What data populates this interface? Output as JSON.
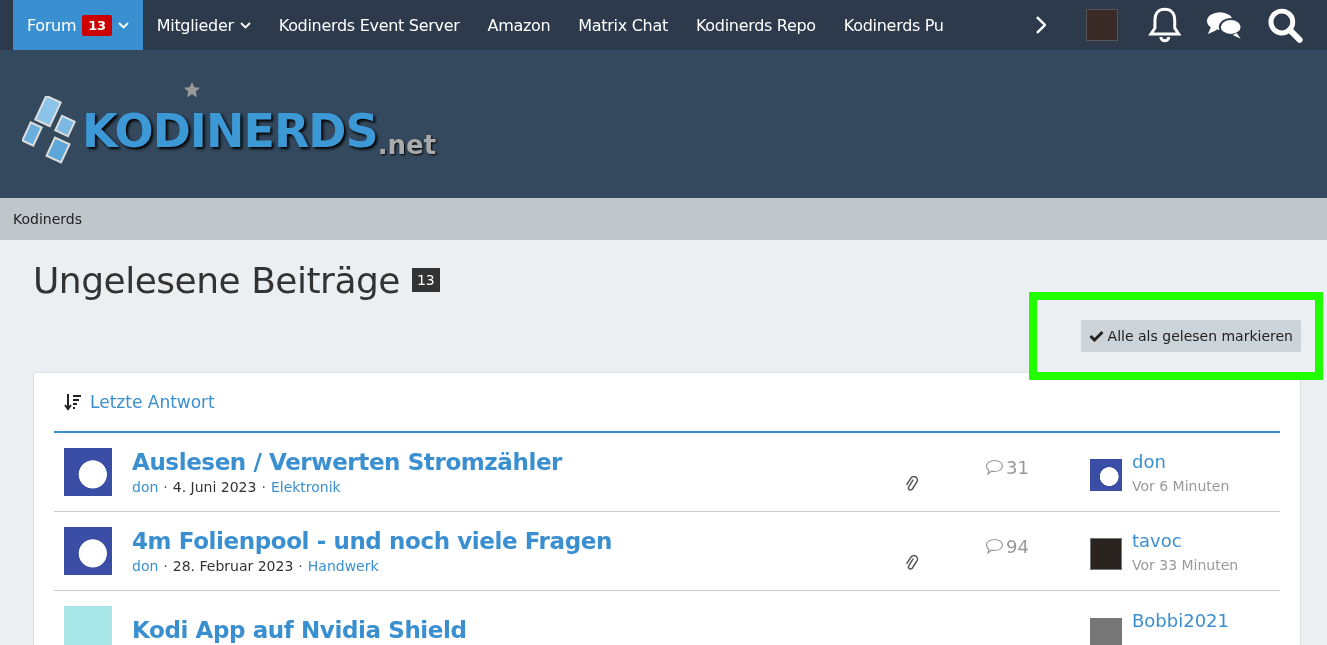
{
  "nav": {
    "items": [
      {
        "label": "Forum",
        "badge": "13",
        "dropdown": true,
        "selected": true
      },
      {
        "label": "Mitglieder",
        "dropdown": true,
        "selected": false
      },
      {
        "label": "Kodinerds Event Server",
        "dropdown": false,
        "selected": false
      },
      {
        "label": "Amazon",
        "dropdown": false,
        "selected": false
      },
      {
        "label": "Matrix Chat",
        "dropdown": false,
        "selected": false
      },
      {
        "label": "Kodinerds Repo",
        "dropdown": false,
        "selected": false
      },
      {
        "label": "Kodinerds Pu",
        "dropdown": false,
        "selected": false
      }
    ]
  },
  "logo": {
    "name": "KODINERDS",
    "suffix": ".net"
  },
  "breadcrumb": [
    "Kodinerds"
  ],
  "page": {
    "title": "Ungelesene Beiträge",
    "count": "13",
    "mark_all_button": "Alle als gelesen markieren"
  },
  "list": {
    "sort_label": "Letzte Antwort",
    "separator": "·",
    "threads": [
      {
        "title": "Auslesen / Verwerten Stromzähler",
        "author": "don",
        "date": "4. Juni 2023",
        "category": "Elektronik",
        "attachment": true,
        "replies": "31",
        "last_user": "don",
        "last_time": "Vor 6 Minuten"
      },
      {
        "title": "4m Folienpool - und noch viele Fragen",
        "author": "don",
        "date": "28. Februar 2023",
        "category": "Handwerk",
        "attachment": true,
        "replies": "94",
        "last_user": "tavoc",
        "last_time": "Vor 33 Minuten"
      },
      {
        "title": "Kodi App auf Nvidia Shield",
        "last_user": "Bobbi2021"
      }
    ]
  }
}
